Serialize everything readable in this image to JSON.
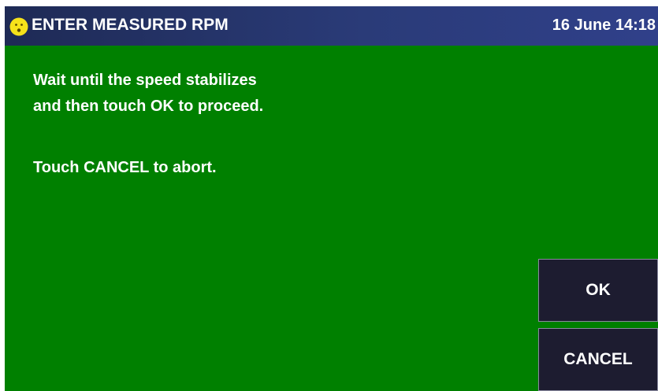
{
  "header": {
    "icon": "smiley-face-icon",
    "icon_color": "#f6e21a",
    "title": "ENTER MEASURED RPM",
    "datetime": "16 June 14:18"
  },
  "message": {
    "line1": "Wait until the speed stabilizes",
    "line2": "and then touch OK to proceed.",
    "line3": "Touch CANCEL to abort."
  },
  "buttons": {
    "ok_label": "OK",
    "cancel_label": "CANCEL"
  },
  "colors": {
    "background": "#008000",
    "titlebar": "#2a3b78",
    "button": "#1d1c30",
    "text": "#ffffff"
  }
}
